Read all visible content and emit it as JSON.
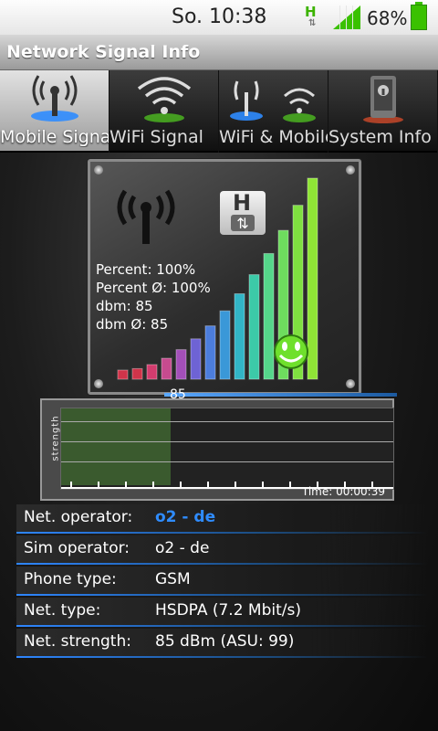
{
  "statusbar": {
    "time": "So. 10:38",
    "net_indicator": "H",
    "battery_text": "68%"
  },
  "app": {
    "title": "Network Signal Info"
  },
  "tabs": [
    {
      "label": "Mobile Signal",
      "active": true,
      "icon": "cell-tower-icon"
    },
    {
      "label": "WiFi Signal",
      "active": false,
      "icon": "wifi-icon"
    },
    {
      "label": "WiFi & Mobile",
      "active": false,
      "icon": "wifi-and-tower-icon"
    },
    {
      "label": "System Info",
      "active": false,
      "icon": "phone-info-icon"
    }
  ],
  "signal": {
    "percent": "Percent: 100%",
    "percent_avg": "Percent Ø: 100%",
    "dbm": "dbm: 85",
    "dbm_avg": "dbm Ø: 85",
    "network_badge": "H",
    "level": 1.0,
    "bar_value": "85"
  },
  "graph": {
    "y_label": "strength",
    "time": "Time: 00:00:39"
  },
  "info": [
    {
      "key": "Net. operator:",
      "value": "o2 - de",
      "accent": true
    },
    {
      "key": "Sim operator:",
      "value": "o2 - de",
      "accent": false
    },
    {
      "key": "Phone type:",
      "value": "GSM",
      "accent": false
    },
    {
      "key": "Net. type:",
      "value": "HSDPA (7.2 Mbit/s)",
      "accent": false
    },
    {
      "key": "Net. strength:",
      "value": "85 dBm (ASU: 99)",
      "accent": false
    }
  ],
  "colors": {
    "accent": "#2f8cff",
    "signal_green": "#6fe02c",
    "statusbar_green": "#3ac100"
  }
}
